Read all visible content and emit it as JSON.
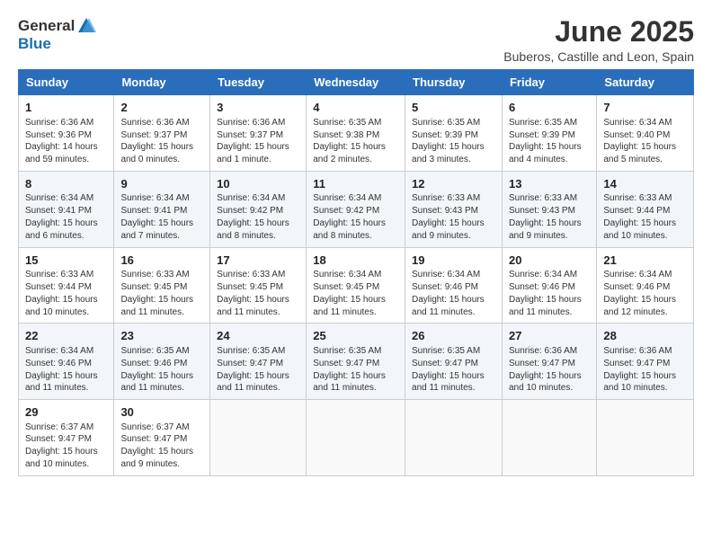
{
  "logo": {
    "general": "General",
    "blue": "Blue"
  },
  "title": "June 2025",
  "subtitle": "Buberos, Castille and Leon, Spain",
  "headers": [
    "Sunday",
    "Monday",
    "Tuesday",
    "Wednesday",
    "Thursday",
    "Friday",
    "Saturday"
  ],
  "weeks": [
    [
      {
        "day": "1",
        "info": "Sunrise: 6:36 AM\nSunset: 9:36 PM\nDaylight: 14 hours\nand 59 minutes."
      },
      {
        "day": "2",
        "info": "Sunrise: 6:36 AM\nSunset: 9:37 PM\nDaylight: 15 hours\nand 0 minutes."
      },
      {
        "day": "3",
        "info": "Sunrise: 6:36 AM\nSunset: 9:37 PM\nDaylight: 15 hours\nand 1 minute."
      },
      {
        "day": "4",
        "info": "Sunrise: 6:35 AM\nSunset: 9:38 PM\nDaylight: 15 hours\nand 2 minutes."
      },
      {
        "day": "5",
        "info": "Sunrise: 6:35 AM\nSunset: 9:39 PM\nDaylight: 15 hours\nand 3 minutes."
      },
      {
        "day": "6",
        "info": "Sunrise: 6:35 AM\nSunset: 9:39 PM\nDaylight: 15 hours\nand 4 minutes."
      },
      {
        "day": "7",
        "info": "Sunrise: 6:34 AM\nSunset: 9:40 PM\nDaylight: 15 hours\nand 5 minutes."
      }
    ],
    [
      {
        "day": "8",
        "info": "Sunrise: 6:34 AM\nSunset: 9:41 PM\nDaylight: 15 hours\nand 6 minutes."
      },
      {
        "day": "9",
        "info": "Sunrise: 6:34 AM\nSunset: 9:41 PM\nDaylight: 15 hours\nand 7 minutes."
      },
      {
        "day": "10",
        "info": "Sunrise: 6:34 AM\nSunset: 9:42 PM\nDaylight: 15 hours\nand 8 minutes."
      },
      {
        "day": "11",
        "info": "Sunrise: 6:34 AM\nSunset: 9:42 PM\nDaylight: 15 hours\nand 8 minutes."
      },
      {
        "day": "12",
        "info": "Sunrise: 6:33 AM\nSunset: 9:43 PM\nDaylight: 15 hours\nand 9 minutes."
      },
      {
        "day": "13",
        "info": "Sunrise: 6:33 AM\nSunset: 9:43 PM\nDaylight: 15 hours\nand 9 minutes."
      },
      {
        "day": "14",
        "info": "Sunrise: 6:33 AM\nSunset: 9:44 PM\nDaylight: 15 hours\nand 10 minutes."
      }
    ],
    [
      {
        "day": "15",
        "info": "Sunrise: 6:33 AM\nSunset: 9:44 PM\nDaylight: 15 hours\nand 10 minutes."
      },
      {
        "day": "16",
        "info": "Sunrise: 6:33 AM\nSunset: 9:45 PM\nDaylight: 15 hours\nand 11 minutes."
      },
      {
        "day": "17",
        "info": "Sunrise: 6:33 AM\nSunset: 9:45 PM\nDaylight: 15 hours\nand 11 minutes."
      },
      {
        "day": "18",
        "info": "Sunrise: 6:34 AM\nSunset: 9:45 PM\nDaylight: 15 hours\nand 11 minutes."
      },
      {
        "day": "19",
        "info": "Sunrise: 6:34 AM\nSunset: 9:46 PM\nDaylight: 15 hours\nand 11 minutes."
      },
      {
        "day": "20",
        "info": "Sunrise: 6:34 AM\nSunset: 9:46 PM\nDaylight: 15 hours\nand 11 minutes."
      },
      {
        "day": "21",
        "info": "Sunrise: 6:34 AM\nSunset: 9:46 PM\nDaylight: 15 hours\nand 12 minutes."
      }
    ],
    [
      {
        "day": "22",
        "info": "Sunrise: 6:34 AM\nSunset: 9:46 PM\nDaylight: 15 hours\nand 11 minutes."
      },
      {
        "day": "23",
        "info": "Sunrise: 6:35 AM\nSunset: 9:46 PM\nDaylight: 15 hours\nand 11 minutes."
      },
      {
        "day": "24",
        "info": "Sunrise: 6:35 AM\nSunset: 9:47 PM\nDaylight: 15 hours\nand 11 minutes."
      },
      {
        "day": "25",
        "info": "Sunrise: 6:35 AM\nSunset: 9:47 PM\nDaylight: 15 hours\nand 11 minutes."
      },
      {
        "day": "26",
        "info": "Sunrise: 6:35 AM\nSunset: 9:47 PM\nDaylight: 15 hours\nand 11 minutes."
      },
      {
        "day": "27",
        "info": "Sunrise: 6:36 AM\nSunset: 9:47 PM\nDaylight: 15 hours\nand 10 minutes."
      },
      {
        "day": "28",
        "info": "Sunrise: 6:36 AM\nSunset: 9:47 PM\nDaylight: 15 hours\nand 10 minutes."
      }
    ],
    [
      {
        "day": "29",
        "info": "Sunrise: 6:37 AM\nSunset: 9:47 PM\nDaylight: 15 hours\nand 10 minutes."
      },
      {
        "day": "30",
        "info": "Sunrise: 6:37 AM\nSunset: 9:47 PM\nDaylight: 15 hours\nand 9 minutes."
      },
      {
        "day": "",
        "info": ""
      },
      {
        "day": "",
        "info": ""
      },
      {
        "day": "",
        "info": ""
      },
      {
        "day": "",
        "info": ""
      },
      {
        "day": "",
        "info": ""
      }
    ]
  ]
}
